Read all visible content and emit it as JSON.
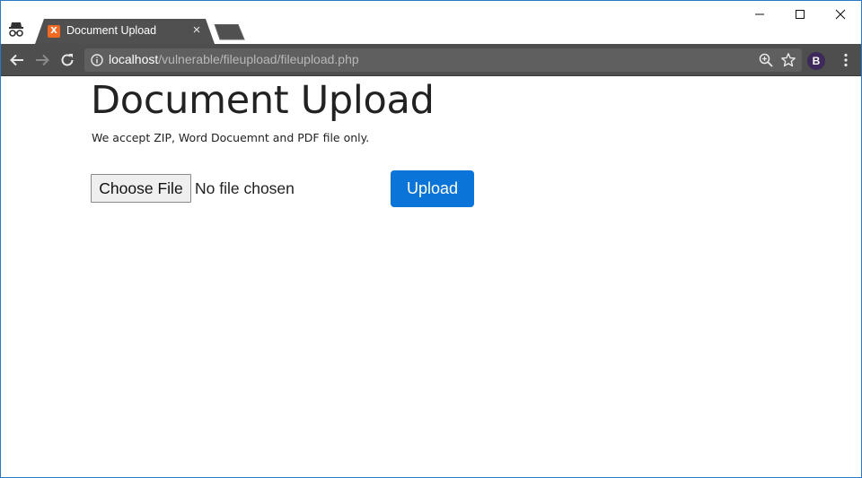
{
  "browser": {
    "tab": {
      "title": "Document Upload",
      "favicon_label": "X",
      "close_glyph": "×"
    },
    "address": {
      "host": "localhost",
      "path": "/vulnerable/fileupload/fileupload.php"
    },
    "profile_badge": "B"
  },
  "page": {
    "heading": "Document Upload",
    "subtitle": "We accept ZIP, Word Docuemnt and PDF file only.",
    "file_input": {
      "button_label": "Choose File",
      "status": "No file chosen"
    },
    "upload_button": "Upload"
  },
  "colors": {
    "toolbar": "#4e4e4e",
    "tab_active": "#505050",
    "accent_button": "#0a74d9",
    "favicon": "#f26a21"
  }
}
